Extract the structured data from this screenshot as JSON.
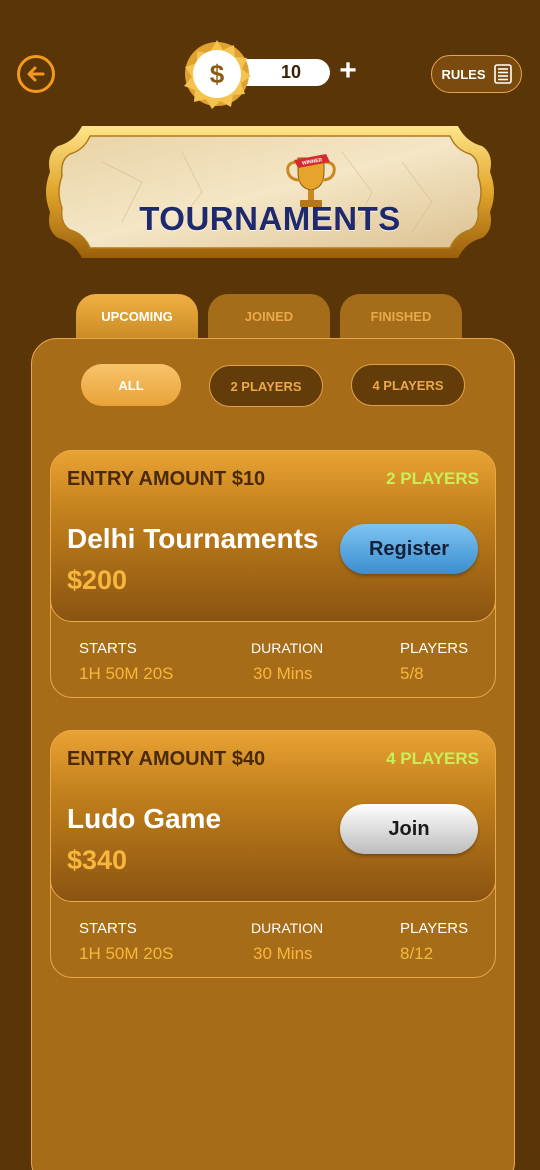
{
  "topbar": {
    "back_icon": "back-arrow-icon",
    "coin_symbol": "$",
    "coin_amount": "10",
    "add_symbol": "+",
    "rules_label": "RULES",
    "rules_icon": "list-icon"
  },
  "banner": {
    "title": "TOURNAMENTS",
    "trophy_ribbon": "WINNER"
  },
  "tabs": [
    {
      "label": "UPCOMING",
      "active": true
    },
    {
      "label": "JOINED",
      "active": false
    },
    {
      "label": "FINISHED",
      "active": false
    }
  ],
  "filters": [
    {
      "label": "ALL",
      "active": true
    },
    {
      "label": "2 PLAYERS",
      "active": false
    },
    {
      "label": "4 PLAYERS",
      "active": false
    }
  ],
  "cards": [
    {
      "entry": "ENTRY AMOUNT $10",
      "players_tag": "2 PLAYERS",
      "name": "Delhi Tournaments",
      "prize": "$200",
      "action": "Register",
      "starts_label": "STARTS",
      "starts_value": "1H 50M 20S",
      "duration_label": "DURATION",
      "duration_value": "30 Mins",
      "players_label": "PLAYERS",
      "players_value": "5/8"
    },
    {
      "entry": "ENTRY AMOUNT $40",
      "players_tag": "4 PLAYERS",
      "name": "Ludo Game",
      "prize": "$340",
      "action": "Join",
      "starts_label": "STARTS",
      "starts_value": "1H 50M 20S",
      "duration_label": "DURATION",
      "duration_value": "30 Mins",
      "players_label": "PLAYERS",
      "players_value": "8/12"
    }
  ],
  "colors": {
    "background": "#5a3508",
    "panel": "#a66c18",
    "accent_orange": "#f29a1e",
    "prize_gold": "#f7b73c",
    "players_green": "#c8ef5a",
    "title_navy": "#1f2a6e",
    "register_blue": "#3b8ed0"
  }
}
